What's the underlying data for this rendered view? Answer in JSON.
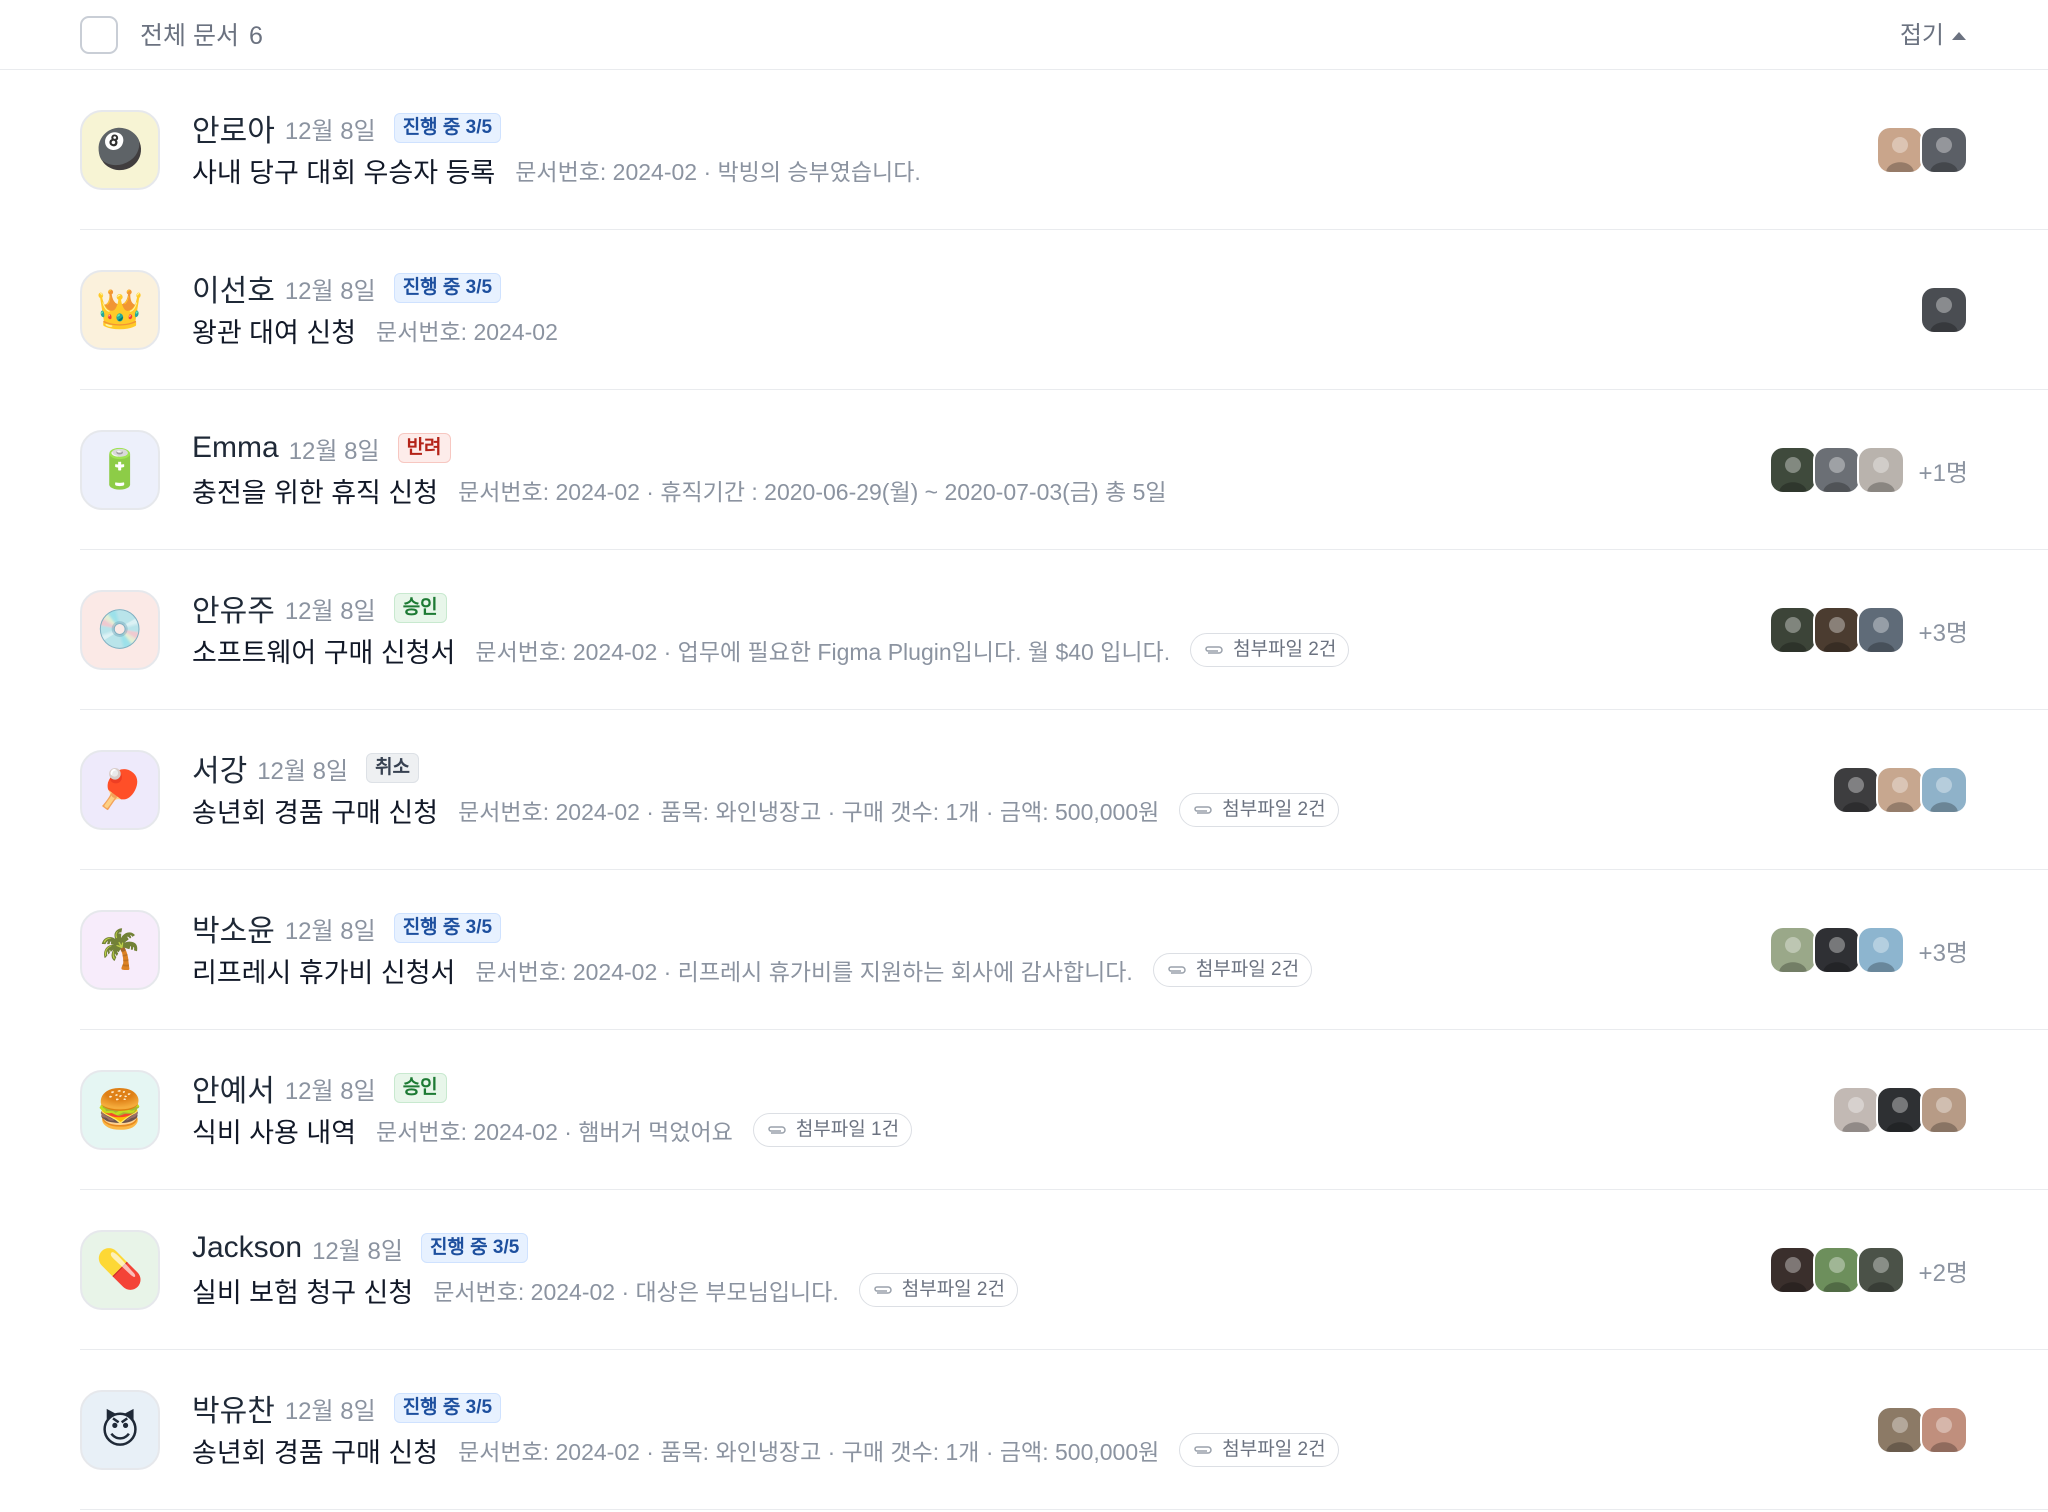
{
  "header": {
    "label": "전체 문서",
    "count": "6",
    "fold_label": "접기"
  },
  "rows": [
    {
      "emoji": "🎱",
      "tile_bg": "#f7f4d4",
      "name": "안로아",
      "date": "12월 8일",
      "status": "진행 중 3/5",
      "title": "사내 당구 대회 우승자 등록",
      "meta": "문서번호: 2024-02 · 박빙의 승부였습니다.",
      "attachment": "",
      "avatars": [
        "#c9a58b",
        "#5b5f66"
      ],
      "extra": ""
    },
    {
      "emoji": "👑",
      "tile_bg": "#fbf1dc",
      "name": "이선호",
      "date": "12월 8일",
      "status": "진행 중 3/5",
      "title": "왕관 대여 신청",
      "meta": "문서번호: 2024-02",
      "attachment": "",
      "avatars": [
        "#4a4d52"
      ],
      "extra": ""
    },
    {
      "emoji": "🔋",
      "tile_bg": "#edf0fb",
      "name": "Emma",
      "date": "12월 8일",
      "status": "반려",
      "title": "충전을 위한 휴직 신청",
      "meta": "문서번호: 2024-02 · 휴직기간 : 2020-06-29(월) ~ 2020-07-03(금) 총 5일",
      "attachment": "",
      "avatars": [
        "#3f4a3c",
        "#6b6f75",
        "#b9b3ad"
      ],
      "extra": "+1명"
    },
    {
      "emoji": "💿",
      "tile_bg": "#fbe9e6",
      "name": "안유주",
      "date": "12월 8일",
      "status": "승인",
      "title": "소프트웨어 구매 신청서",
      "meta": "문서번호: 2024-02 · 업무에 필요한 Figma Plugin입니다. 월 $40 입니다.",
      "attachment": "첨부파일 2건",
      "avatars": [
        "#3c4438",
        "#4b3c30",
        "#5f6b78"
      ],
      "extra": "+3명"
    },
    {
      "emoji": "🏓",
      "tile_bg": "#eeeafb",
      "name": "서강",
      "date": "12월 8일",
      "status": "취소",
      "title": "송년회 경품 구매 신청",
      "meta": "문서번호: 2024-02 · 품목: 와인냉장고 · 구매 갯수: 1개 · 금액: 500,000원",
      "attachment": "첨부파일 2건",
      "avatars": [
        "#3d3d3f",
        "#c7a78f",
        "#8fb2c9"
      ],
      "extra": ""
    },
    {
      "emoji": "🌴",
      "tile_bg": "#f7ecfb",
      "name": "박소윤",
      "date": "12월 8일",
      "status": "진행 중 3/5",
      "title": "리프레시 휴가비 신청서",
      "meta": "문서번호: 2024-02 · 리프레시 휴가비를 지원하는 회사에 감사합니다.",
      "attachment": "첨부파일 2건",
      "avatars": [
        "#9aa889",
        "#2f3034",
        "#8db5cf"
      ],
      "extra": "+3명"
    },
    {
      "emoji": "🍔",
      "tile_bg": "#e5f6f3",
      "name": "안예서",
      "date": "12월 8일",
      "status": "승인",
      "title": "식비 사용 내역",
      "meta": "문서번호: 2024-02 · 햄버거 먹었어요",
      "attachment": "첨부파일 1건",
      "avatars": [
        "#c2b9b4",
        "#2e3033",
        "#b79b86"
      ],
      "extra": ""
    },
    {
      "emoji": "💊",
      "tile_bg": "#e8f4e8",
      "name": "Jackson",
      "date": "12월 8일",
      "status": "진행 중 3/5",
      "title": "실비 보험 청구 신청",
      "meta": "문서번호: 2024-02 ·  대상은 부모님입니다.",
      "attachment": "첨부파일 2건",
      "avatars": [
        "#3a2f2c",
        "#6d8f5c",
        "#4b5248"
      ],
      "extra": "+2명"
    },
    {
      "emoji": "😈",
      "tile_bg": "#e8f0f7",
      "name": "박유찬",
      "date": "12월 8일",
      "status": "진행 중 3/5",
      "title": "송년회 경품 구매 신청",
      "meta": "문서번호: 2024-02 · 품목: 와인냉장고 · 구매 갯수: 1개 · 금액: 500,000원",
      "attachment": "첨부파일 2건",
      "avatars": [
        "#8c7a66",
        "#c08f7d"
      ],
      "extra": ""
    }
  ]
}
